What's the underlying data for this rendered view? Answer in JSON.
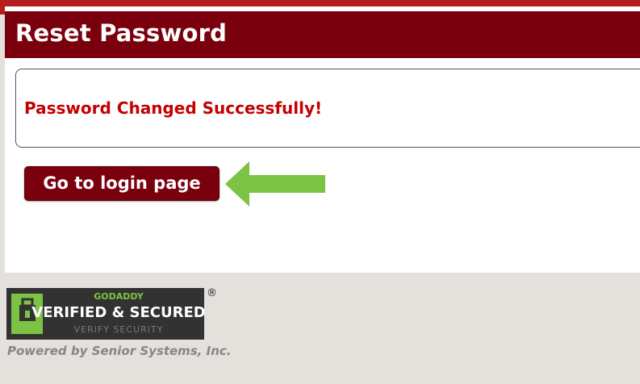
{
  "header": {
    "title": "Reset Password"
  },
  "message": {
    "text": "Password Changed Successfully!"
  },
  "actions": {
    "login_label": "Go to login page"
  },
  "security_badge": {
    "brand": "GODADDY",
    "status": "VERIFIED & SECURED",
    "link": "VERIFY SECURITY",
    "registered_mark": "®"
  },
  "footer": {
    "powered_by": "Powered by Senior Systems, Inc."
  },
  "colors": {
    "header_bg": "#7a000e",
    "message_text": "#c40000",
    "arrow": "#7dc343",
    "page_bg": "#e4e1dd"
  },
  "icons": {
    "arrow": "left-arrow-icon",
    "badge_lock": "lock-icon"
  }
}
